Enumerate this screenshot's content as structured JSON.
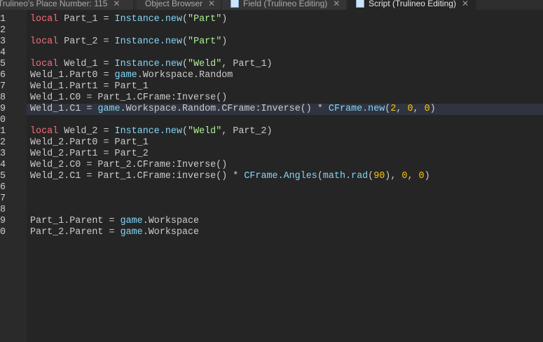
{
  "tabs": [
    {
      "label": "Trulineo's Place Number: 115",
      "icon": "cloud-icon",
      "active": false
    },
    {
      "label": "Object Browser",
      "icon": null,
      "active": false
    },
    {
      "label": "Field (Trulineo Editing)",
      "icon": "script-icon",
      "active": false
    },
    {
      "label": "Script (Trulineo Editing)",
      "icon": "script-icon",
      "active": true
    }
  ],
  "close_glyph": "✕",
  "highlighted_line": 9,
  "lines": [
    [
      [
        "kw",
        "local"
      ],
      [
        "t",
        " Part_1 = "
      ],
      [
        "bi",
        "Instance.new"
      ],
      [
        "t",
        "("
      ],
      [
        "st",
        "\"Part\""
      ],
      [
        "t",
        ")"
      ]
    ],
    [],
    [
      [
        "kw",
        "local"
      ],
      [
        "t",
        " Part_2 = "
      ],
      [
        "bi",
        "Instance.new"
      ],
      [
        "t",
        "("
      ],
      [
        "st",
        "\"Part\""
      ],
      [
        "t",
        ")"
      ]
    ],
    [],
    [
      [
        "kw",
        "local"
      ],
      [
        "t",
        " Weld_1 = "
      ],
      [
        "bi",
        "Instance.new"
      ],
      [
        "t",
        "("
      ],
      [
        "st",
        "\"Weld\""
      ],
      [
        "t",
        ", Part_1)"
      ]
    ],
    [
      [
        "t",
        "Weld_1.Part0 = "
      ],
      [
        "bi",
        "game"
      ],
      [
        "t",
        ".Workspace.Random"
      ]
    ],
    [
      [
        "t",
        "Weld_1.Part1 = Part_1"
      ]
    ],
    [
      [
        "t",
        "Weld_1.C0 = Part_1.CFrame:Inverse()"
      ]
    ],
    [
      [
        "t",
        "Weld_1.C1 = "
      ],
      [
        "bi",
        "game"
      ],
      [
        "t",
        ".Workspace.Random.CFrame:Inverse() * "
      ],
      [
        "bi",
        "CFrame.new"
      ],
      [
        "t",
        "("
      ],
      [
        "nu",
        "2"
      ],
      [
        "t",
        ", "
      ],
      [
        "nu",
        "0"
      ],
      [
        "t",
        ", "
      ],
      [
        "nu",
        "0"
      ],
      [
        "t",
        ")"
      ]
    ],
    [],
    [
      [
        "kw",
        "local"
      ],
      [
        "t",
        " Weld_2 = "
      ],
      [
        "bi",
        "Instance.new"
      ],
      [
        "t",
        "("
      ],
      [
        "st",
        "\"Weld\""
      ],
      [
        "t",
        ", Part_2)"
      ]
    ],
    [
      [
        "t",
        "Weld_2.Part0 = Part_1"
      ]
    ],
    [
      [
        "t",
        "Weld_2.Part1 = Part_2"
      ]
    ],
    [
      [
        "t",
        "Weld_2.C0 = Part_2.CFrame:Inverse()"
      ]
    ],
    [
      [
        "t",
        "Weld_2.C1 = Part_1.CFrame:inverse() * "
      ],
      [
        "bi",
        "CFrame.Angles"
      ],
      [
        "t",
        "("
      ],
      [
        "bi",
        "math.rad"
      ],
      [
        "t",
        "("
      ],
      [
        "nu",
        "90"
      ],
      [
        "t",
        "), "
      ],
      [
        "nu",
        "0"
      ],
      [
        "t",
        ", "
      ],
      [
        "nu",
        "0"
      ],
      [
        "t",
        ")"
      ]
    ],
    [],
    [],
    [],
    [
      [
        "t",
        "Part_1.Parent = "
      ],
      [
        "bi",
        "game"
      ],
      [
        "t",
        ".Workspace"
      ]
    ],
    [
      [
        "t",
        "Part_2.Parent = "
      ],
      [
        "bi",
        "game"
      ],
      [
        "t",
        ".Workspace"
      ]
    ]
  ]
}
